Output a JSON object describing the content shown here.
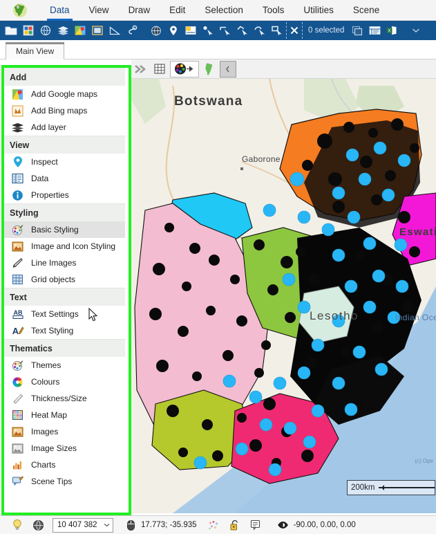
{
  "app": {
    "logo_icon": "africa-globe-logo"
  },
  "menubar": {
    "items": [
      {
        "label": "Data",
        "active": true
      },
      {
        "label": "View",
        "active": false
      },
      {
        "label": "Draw",
        "active": false
      },
      {
        "label": "Edit",
        "active": false
      },
      {
        "label": "Selection",
        "active": false
      },
      {
        "label": "Tools",
        "active": false
      },
      {
        "label": "Utilities",
        "active": false
      },
      {
        "label": "Scene",
        "active": false
      }
    ]
  },
  "ribbon": {
    "selection_status": "0 selected",
    "icons": [
      "open-folder-icon",
      "save-table-icon",
      "database-globe-icon",
      "layers-icon",
      "google-maps-icon",
      "image-frame-icon",
      "measure-triangle-icon",
      "lasso-icon",
      "wireframe-globe-icon",
      "map-pin-icon",
      "label-note-icon",
      "select-point-icon",
      "select-line-icon",
      "select-polyline-icon",
      "select-freehand-icon",
      "select-rectangle-icon",
      "clear-selection-icon",
      "copy-selection-icon",
      "table-list-icon",
      "excel-export-icon",
      "chevron-down-icon"
    ]
  },
  "tabs": {
    "items": [
      {
        "label": "Main View",
        "active": true
      }
    ]
  },
  "map_toolbar": {
    "buttons": [
      {
        "icon": "fast-forward-icon",
        "state": "normal"
      },
      {
        "icon": "grid-icon",
        "state": "normal"
      },
      {
        "icon": "palette-picker-icon",
        "state": "boxed"
      },
      {
        "icon": "africa-shape-icon",
        "state": "normal"
      },
      {
        "icon": "collapse-handle-icon",
        "state": "pressed"
      }
    ]
  },
  "panel": {
    "highlight_color": "#22ee22",
    "groups": [
      {
        "title": "Add",
        "items": [
          {
            "label": "Add Google maps",
            "icon": "google-maps-icon",
            "selected": false
          },
          {
            "label": "Add Bing maps",
            "icon": "bing-maps-icon",
            "selected": false
          },
          {
            "label": "Add layer",
            "icon": "layers-icon",
            "selected": false
          }
        ]
      },
      {
        "title": "View",
        "items": [
          {
            "label": "Inspect",
            "icon": "map-pin-icon",
            "selected": false
          },
          {
            "label": "Data",
            "icon": "table-data-icon",
            "selected": false
          },
          {
            "label": "Properties",
            "icon": "info-circle-icon",
            "selected": false
          }
        ]
      },
      {
        "title": "Styling",
        "items": [
          {
            "label": "Basic Styling",
            "icon": "paint-palette-icon",
            "selected": true
          },
          {
            "label": "Image and Icon Styling",
            "icon": "picture-icon",
            "selected": false
          },
          {
            "label": "Line Images",
            "icon": "line-pencil-icon",
            "selected": false
          },
          {
            "label": "Grid objects",
            "icon": "grid-icon",
            "selected": false
          }
        ]
      },
      {
        "title": "Text",
        "items": [
          {
            "label": "Text Settings",
            "icon": "ab-text-icon",
            "selected": false
          },
          {
            "label": "Text Styling",
            "icon": "a-pen-icon",
            "selected": false
          }
        ]
      },
      {
        "title": "Thematics",
        "items": [
          {
            "label": "Themes",
            "icon": "paint-palette-icon",
            "selected": false
          },
          {
            "label": "Colours",
            "icon": "color-wheel-icon",
            "selected": false
          },
          {
            "label": "Thickness/Size",
            "icon": "thickness-icon",
            "selected": false
          },
          {
            "label": "Heat Map",
            "icon": "heatmap-grid-icon",
            "selected": false
          },
          {
            "label": "Images",
            "icon": "picture-icon",
            "selected": false
          },
          {
            "label": "Image Sizes",
            "icon": "picture-sizes-icon",
            "selected": false
          },
          {
            "label": "Charts",
            "icon": "bar-chart-icon",
            "selected": false
          },
          {
            "label": "Scene Tips",
            "icon": "scene-tip-icon",
            "selected": false
          }
        ]
      }
    ]
  },
  "map": {
    "labels": {
      "botswana": "Botswana",
      "gaborone": "Gaborone",
      "lesotho": "Lesotho",
      "eswatini": "Eswatini",
      "ocean": "Indian Ocean"
    },
    "scale_bar": "200km",
    "attribution": "(c) Ope"
  },
  "statusbar": {
    "lightbulb_icon": "lightbulb-icon",
    "globe_icon": "wireframe-globe-icon",
    "zoom_value": "10 407 382",
    "mouse_icon": "mouse-icon",
    "coordinates": "17.773; -35.935",
    "scatter_icon": "scatter-points-icon",
    "lock_icon": "unlocked-padlock-icon",
    "note_icon": "note-icon",
    "eye_icon": "eye-icon",
    "rotation": "-90.00, 0.00, 0.00"
  }
}
